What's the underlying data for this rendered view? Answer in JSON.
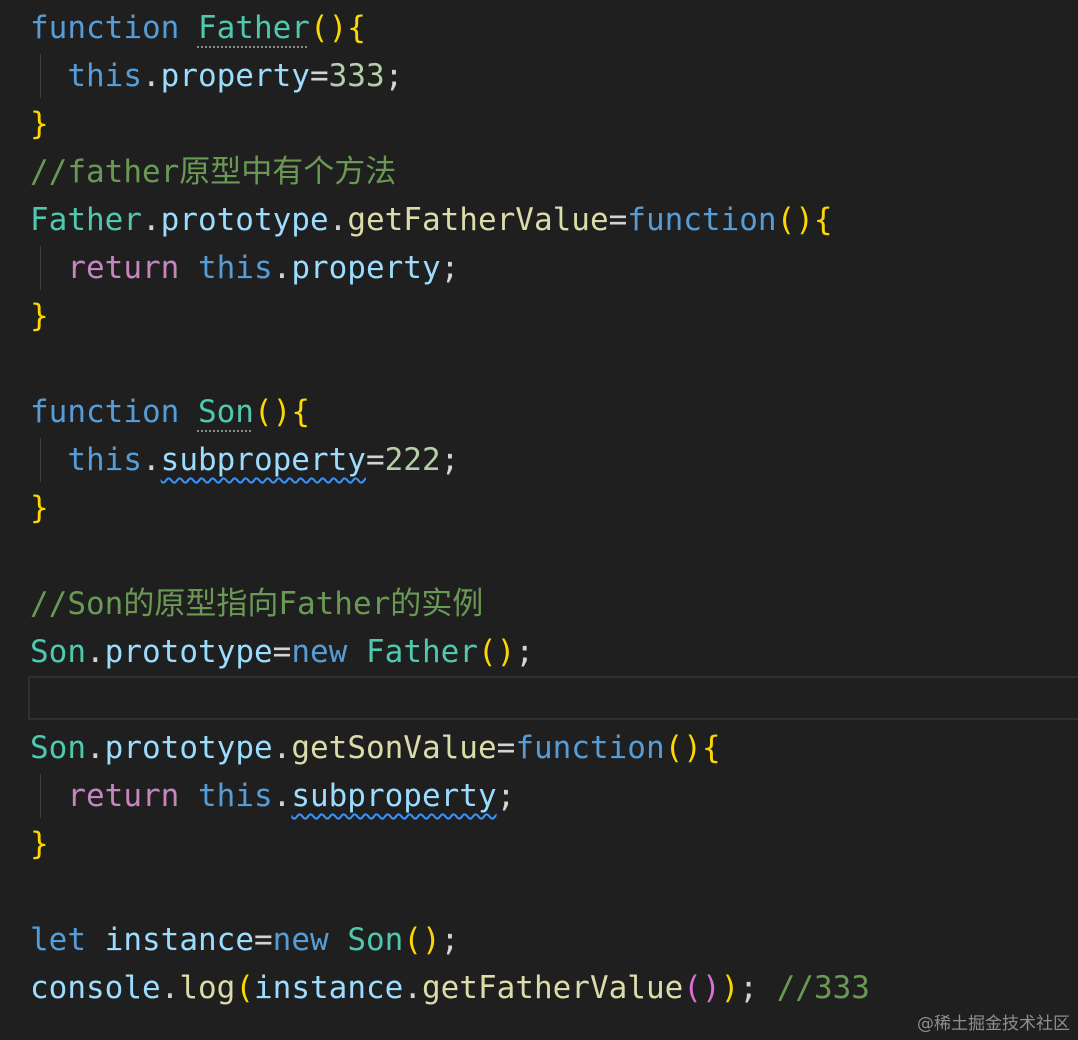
{
  "editor": {
    "language": "javascript",
    "theme_colors": {
      "background": "#1f1f1f",
      "keyword": "#569cd6",
      "control_keyword": "#c586c0",
      "class_identifier": "#4ec9b0",
      "method": "#dcdcaa",
      "property": "#9cdcfe",
      "number": "#b5cea8",
      "comment": "#6a9955",
      "bracket_level1": "#ffd700",
      "bracket_level2": "#da70d6",
      "squiggle": "#3794ff"
    },
    "lines": [
      {
        "tokens": [
          {
            "t": "function",
            "c": "kw-fn"
          },
          {
            "t": " ",
            "c": "punc"
          },
          {
            "t": "Father",
            "c": "ident",
            "dots": true
          },
          {
            "t": "()",
            "c": "brace"
          },
          {
            "t": "{",
            "c": "brace"
          }
        ]
      },
      {
        "tokens": [
          {
            "t": "  ",
            "c": "punc"
          },
          {
            "t": "this",
            "c": "kw-fn"
          },
          {
            "t": ".",
            "c": "punc"
          },
          {
            "t": "property",
            "c": "prop"
          },
          {
            "t": "=",
            "c": "punc"
          },
          {
            "t": "333",
            "c": "num"
          },
          {
            "t": ";",
            "c": "punc"
          }
        ]
      },
      {
        "tokens": [
          {
            "t": "}",
            "c": "brace"
          }
        ]
      },
      {
        "tokens": [
          {
            "t": "//father原型中有个方法",
            "c": "comment"
          }
        ]
      },
      {
        "tokens": [
          {
            "t": "Father",
            "c": "ident"
          },
          {
            "t": ".",
            "c": "punc"
          },
          {
            "t": "prototype",
            "c": "prop"
          },
          {
            "t": ".",
            "c": "punc"
          },
          {
            "t": "getFatherValue",
            "c": "method"
          },
          {
            "t": "=",
            "c": "punc"
          },
          {
            "t": "function",
            "c": "kw-fn"
          },
          {
            "t": "()",
            "c": "brace"
          },
          {
            "t": "{",
            "c": "brace"
          }
        ]
      },
      {
        "tokens": [
          {
            "t": "  ",
            "c": "punc"
          },
          {
            "t": "return",
            "c": "kw-ctl"
          },
          {
            "t": " ",
            "c": "punc"
          },
          {
            "t": "this",
            "c": "kw-fn"
          },
          {
            "t": ".",
            "c": "punc"
          },
          {
            "t": "property",
            "c": "prop"
          },
          {
            "t": ";",
            "c": "punc"
          }
        ]
      },
      {
        "tokens": [
          {
            "t": "}",
            "c": "brace"
          }
        ]
      },
      {
        "tokens": []
      },
      {
        "tokens": [
          {
            "t": "function",
            "c": "kw-fn"
          },
          {
            "t": " ",
            "c": "punc"
          },
          {
            "t": "Son",
            "c": "ident",
            "dots": true
          },
          {
            "t": "()",
            "c": "brace"
          },
          {
            "t": "{",
            "c": "brace"
          }
        ]
      },
      {
        "tokens": [
          {
            "t": "  ",
            "c": "punc"
          },
          {
            "t": "this",
            "c": "kw-fn"
          },
          {
            "t": ".",
            "c": "punc"
          },
          {
            "t": "subproperty",
            "c": "prop",
            "squiggle": true
          },
          {
            "t": "=",
            "c": "punc"
          },
          {
            "t": "222",
            "c": "num"
          },
          {
            "t": ";",
            "c": "punc"
          }
        ]
      },
      {
        "tokens": [
          {
            "t": "}",
            "c": "brace"
          }
        ]
      },
      {
        "tokens": []
      },
      {
        "tokens": [
          {
            "t": "//Son的原型指向Father的实例",
            "c": "comment"
          }
        ]
      },
      {
        "tokens": [
          {
            "t": "Son",
            "c": "ident"
          },
          {
            "t": ".",
            "c": "punc"
          },
          {
            "t": "prototype",
            "c": "prop"
          },
          {
            "t": "=",
            "c": "punc"
          },
          {
            "t": "new",
            "c": "kw-fn"
          },
          {
            "t": " ",
            "c": "punc"
          },
          {
            "t": "Father",
            "c": "ident"
          },
          {
            "t": "()",
            "c": "brace"
          },
          {
            "t": ";",
            "c": "punc"
          }
        ]
      },
      {
        "tokens": [],
        "current": true
      },
      {
        "tokens": [
          {
            "t": "Son",
            "c": "ident"
          },
          {
            "t": ".",
            "c": "punc"
          },
          {
            "t": "prototype",
            "c": "prop"
          },
          {
            "t": ".",
            "c": "punc"
          },
          {
            "t": "getSonValue",
            "c": "method"
          },
          {
            "t": "=",
            "c": "punc"
          },
          {
            "t": "function",
            "c": "kw-fn"
          },
          {
            "t": "()",
            "c": "brace"
          },
          {
            "t": "{",
            "c": "brace"
          }
        ]
      },
      {
        "tokens": [
          {
            "t": "  ",
            "c": "punc"
          },
          {
            "t": "return",
            "c": "kw-ctl"
          },
          {
            "t": " ",
            "c": "punc"
          },
          {
            "t": "this",
            "c": "kw-fn"
          },
          {
            "t": ".",
            "c": "punc"
          },
          {
            "t": "subproperty",
            "c": "prop",
            "squiggle": true
          },
          {
            "t": ";",
            "c": "punc"
          }
        ]
      },
      {
        "tokens": [
          {
            "t": "}",
            "c": "brace"
          }
        ]
      },
      {
        "tokens": []
      },
      {
        "tokens": [
          {
            "t": "let",
            "c": "kw-fn"
          },
          {
            "t": " ",
            "c": "punc"
          },
          {
            "t": "instance",
            "c": "prop"
          },
          {
            "t": "=",
            "c": "punc"
          },
          {
            "t": "new",
            "c": "kw-fn"
          },
          {
            "t": " ",
            "c": "punc"
          },
          {
            "t": "Son",
            "c": "ident"
          },
          {
            "t": "()",
            "c": "brace"
          },
          {
            "t": ";",
            "c": "punc"
          }
        ]
      },
      {
        "tokens": [
          {
            "t": "console",
            "c": "prop"
          },
          {
            "t": ".",
            "c": "punc"
          },
          {
            "t": "log",
            "c": "method"
          },
          {
            "t": "(",
            "c": "brace"
          },
          {
            "t": "instance",
            "c": "prop"
          },
          {
            "t": ".",
            "c": "punc"
          },
          {
            "t": "getFatherValue",
            "c": "method"
          },
          {
            "t": "()",
            "c": "paren2"
          },
          {
            "t": ")",
            "c": "brace"
          },
          {
            "t": ";",
            "c": "punc"
          },
          {
            "t": " ",
            "c": "punc"
          },
          {
            "t": "//333",
            "c": "comment"
          }
        ]
      }
    ]
  },
  "watermark": "@稀土掘金技术社区"
}
